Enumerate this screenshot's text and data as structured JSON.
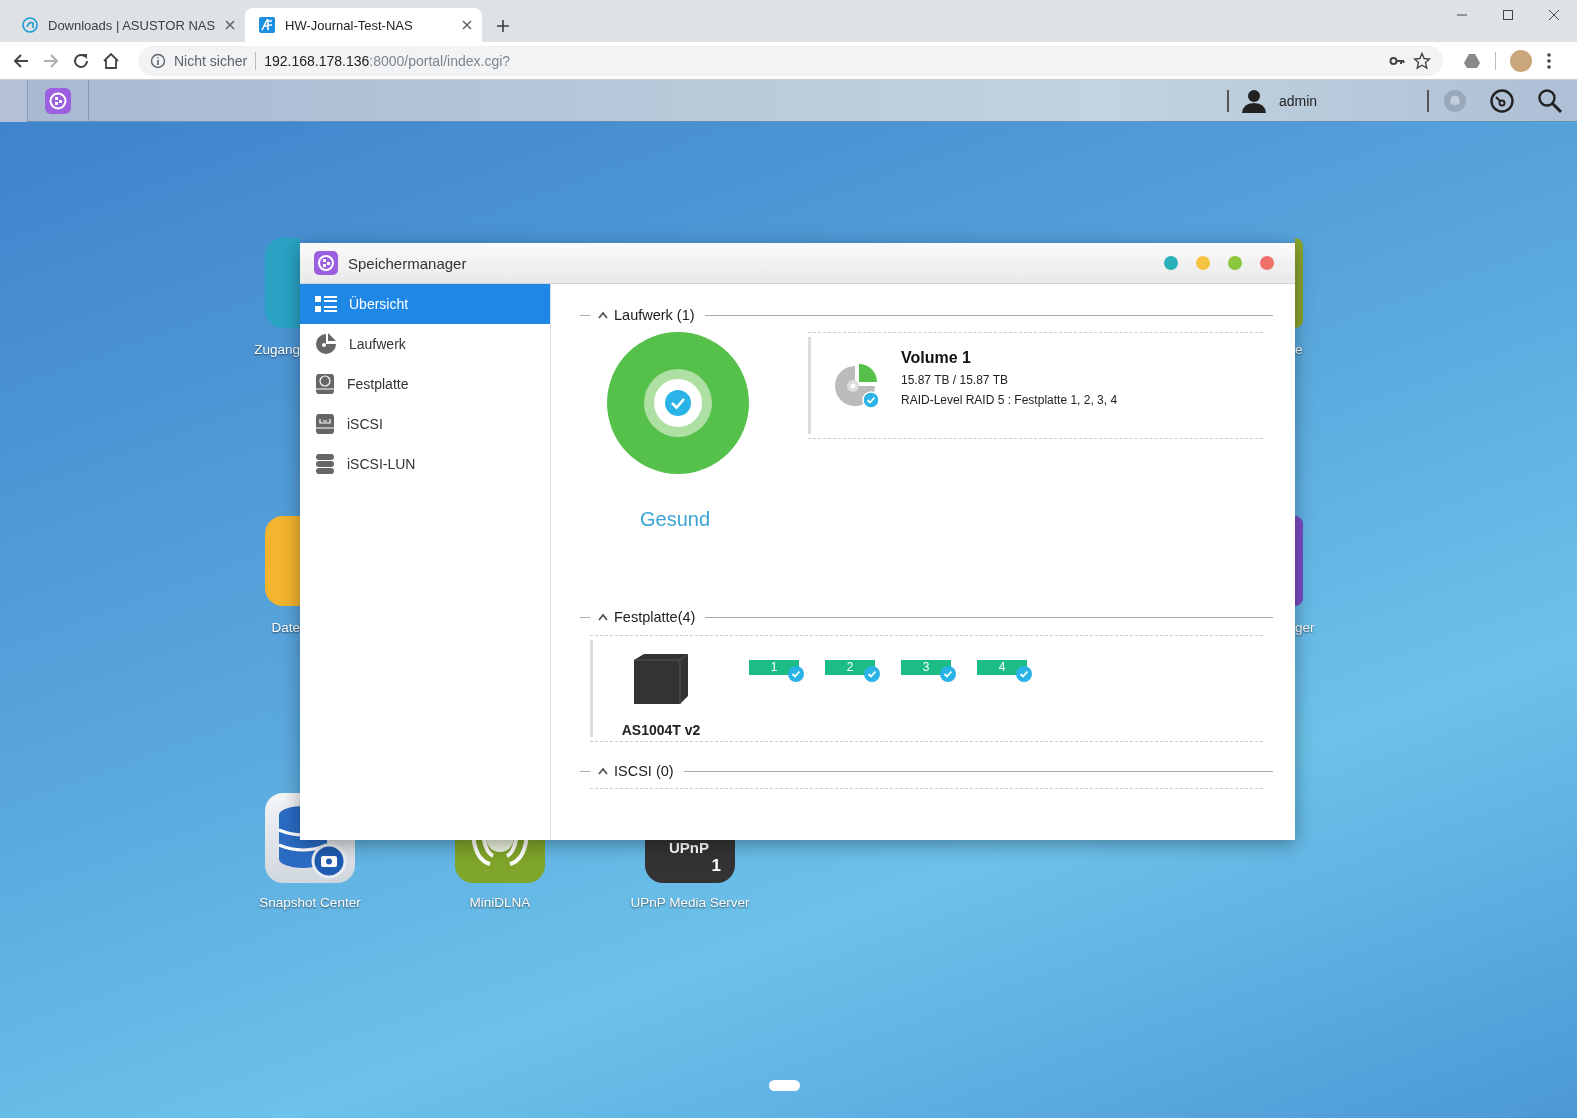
{
  "browser": {
    "tabs": [
      {
        "title": "Downloads | ASUSTOR NAS",
        "selected": false,
        "kind": "asustor"
      },
      {
        "title": "HW-Journal-Test-NAS",
        "selected": true,
        "kind": "adm"
      }
    ],
    "forward_enabled": false,
    "address_bar": {
      "security_label": "Nicht sicher",
      "host": "192.168.178.136",
      "path": ":8000/portal/index.cgi?"
    }
  },
  "taskbar": {
    "user": "admin"
  },
  "desktop_icons": [
    {
      "kind": "access",
      "label": "Zugang"
    },
    {
      "kind": "files",
      "label": "Date"
    },
    {
      "kind": "olive",
      "label": "e"
    },
    {
      "kind": "purple",
      "label": "ger"
    },
    {
      "kind": "snapshot",
      "label": "Snapshot Center"
    },
    {
      "kind": "minidlna",
      "label": "MiniDLNA"
    },
    {
      "kind": "upnp",
      "label": "UPnP Media Server",
      "icon_text": "UPnP",
      "icon_number": "1"
    }
  ],
  "window": {
    "title": "Speichermanager",
    "sidebar": {
      "items": [
        {
          "label": "Übersicht",
          "kind": "overview",
          "selected": true
        },
        {
          "label": "Laufwerk",
          "kind": "volume",
          "selected": false
        },
        {
          "label": "Festplatte",
          "kind": "disk",
          "selected": false
        },
        {
          "label": "iSCSI",
          "kind": "iscsi",
          "selected": false
        },
        {
          "label": "iSCSI-LUN",
          "kind": "lun",
          "selected": false
        }
      ]
    },
    "sections": [
      {
        "kind": "volumes",
        "title": "Laufwerk (1)",
        "expanded": true,
        "status": "Gesund",
        "volumes": [
          {
            "name": "Volume 1",
            "capacity": "15.87 TB / 15.87 TB",
            "raid": "RAID-Level RAID 5 : Festplatte 1, 2, 3, 4",
            "healthy": true
          }
        ]
      },
      {
        "kind": "disks",
        "title": "Festplatte(4)",
        "expanded": true,
        "device": "AS1004T v2",
        "disks": [
          {
            "label": "1",
            "healthy": true
          },
          {
            "label": "2",
            "healthy": true
          },
          {
            "label": "3",
            "healthy": true
          },
          {
            "label": "4",
            "healthy": true
          }
        ]
      },
      {
        "kind": "iscsi",
        "title": "ISCSI (0)",
        "expanded": true
      }
    ]
  }
}
